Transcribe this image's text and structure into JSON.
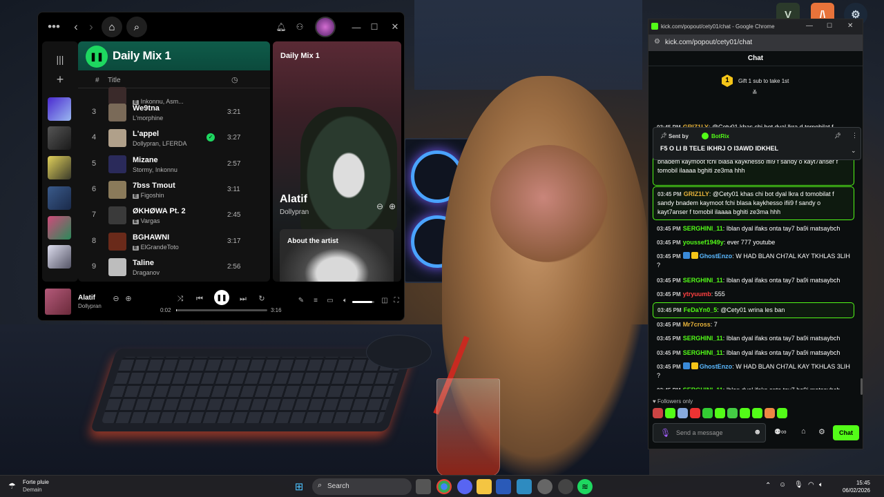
{
  "spotify": {
    "playlist_title": "Daily Mix 1",
    "col_index": "#",
    "col_title": "Title",
    "rows": [
      {
        "num": "",
        "name": "",
        "artist": "Inkonnu, Asm...",
        "explicit": true,
        "duration": "",
        "liked": false,
        "color": "#3a2a2a"
      },
      {
        "num": "3",
        "name": "We9tna",
        "artist": "L'morphine",
        "explicit": false,
        "duration": "3:21",
        "liked": false,
        "color": "#7a6a58"
      },
      {
        "num": "4",
        "name": "L'appel",
        "artist": "Dollypran, LFERDA",
        "explicit": false,
        "duration": "3:27",
        "liked": true,
        "color": "#b0a08a"
      },
      {
        "num": "5",
        "name": "Mizane",
        "artist": "Stormy, Inkonnu",
        "explicit": false,
        "duration": "2:57",
        "liked": false,
        "color": "#2a2a5a"
      },
      {
        "num": "6",
        "name": "7bss Tmout",
        "artist": "Figoshin",
        "explicit": true,
        "duration": "3:11",
        "liked": false,
        "color": "#8a7a5a"
      },
      {
        "num": "7",
        "name": "ØKHØWA Pt. 2",
        "artist": "Vargas",
        "explicit": true,
        "duration": "2:45",
        "liked": false,
        "color": "#3a3a3a"
      },
      {
        "num": "8",
        "name": "BGHAWNI",
        "artist": "ElGrandeToto",
        "explicit": true,
        "duration": "3:17",
        "liked": false,
        "color": "#6a2a1a"
      },
      {
        "num": "9",
        "name": "Taline",
        "artist": "Draganov",
        "explicit": false,
        "duration": "2:56",
        "liked": false,
        "color": "#bdbdbd"
      }
    ],
    "now_playing_panel": {
      "heading": "Daily Mix 1",
      "artist": "Alatif",
      "subtitle": "Dollypran",
      "about_label": "About the artist"
    },
    "player": {
      "track": "Alatif",
      "artist": "Dollypran",
      "elapsed": "0:02",
      "total": "3:16",
      "progress": 0.01,
      "volume": 0.9
    }
  },
  "chrome": {
    "window_title": "kick.com/popout/cety01/chat - Google Chrome",
    "url": "kick.com/popout/cety01/chat",
    "chat_header": "Chat",
    "gift_badge": "1",
    "gift_text": "Gift 1 sub to take 1st",
    "pinned": {
      "sent_by_label": "Sent by",
      "sender": "BotRix",
      "text": "F5 O LI B TELE IKHRJ O I3AWD IDKHEL"
    },
    "messages": [
      {
        "time": "03:45 PM",
        "user": "GRIZ1LY",
        "color": "#e7b33a",
        "text": "@Cety01 khas chi bot dyal lkra d tomobilat f sandy",
        "highlight": false
      },
      {
        "time": "03:45 PM",
        "user": "",
        "color": "#ffffff",
        "text": "bnadem kaymoot fchi blasa kaykhesso ifii9 f sandy o kayt7anser f tomobil ilaaaa bghiti ze3ma hhh",
        "highlight": true
      },
      {
        "time": "03:45 PM",
        "user": "GRIZ1LY",
        "color": "#e7b33a",
        "text": "@Cety01 khas chi bot dyal lkra d tomobilat f sandy bnadem kaymoot fchi blasa kaykhesso ifii9 f sandy o kayt7anser f tomobil ilaaaa bghiti ze3ma hhh",
        "highlight": true
      },
      {
        "time": "03:45 PM",
        "user": "SERGHINI_11",
        "color": "#53fc18",
        "text": "Iblan dyal ifaks onta tay7 ba9i matsaybch",
        "highlight": false
      },
      {
        "time": "03:45 PM",
        "user": "youssef1949y",
        "color": "#53fc18",
        "text": "ever 777 youtube",
        "highlight": false
      },
      {
        "time": "03:45 PM",
        "user": "GhostEnzo",
        "color": "#5ab8ff",
        "text": "W HAD BLAN CH7AL KAY TKHLAS 3LIH ?",
        "highlight": false
      },
      {
        "time": "03:45 PM",
        "user": "SERGHINI_11",
        "color": "#53fc18",
        "text": "Iblan dyal ifaks onta tay7 ba9i matsaybch",
        "highlight": false
      },
      {
        "time": "03:45 PM",
        "user": "ytryuumb",
        "color": "#ff4040",
        "text": "555",
        "highlight": false
      },
      {
        "time": "03:45 PM",
        "user": "FeDaYn0_5",
        "color": "#53fc18",
        "text": "@Cety01 wrina les ban",
        "highlight": true
      },
      {
        "time": "03:45 PM",
        "user": "Mr7cross",
        "color": "#e7b33a",
        "text": "7",
        "highlight": false
      },
      {
        "time": "03:45 PM",
        "user": "SERGHINI_11",
        "color": "#53fc18",
        "text": "Iblan dyal ifaks onta tay7 ba9i matsaybch",
        "highlight": false
      },
      {
        "time": "03:45 PM",
        "user": "SERGHINI_11",
        "color": "#53fc18",
        "text": "Iblan dyal ifaks onta tay7 ba9i matsaybch",
        "highlight": false
      },
      {
        "time": "03:45 PM",
        "user": "GhostEnzo",
        "color": "#5ab8ff",
        "text": "W HAD BLAN CH7AL KAY TKHLAS 3LIH ?",
        "highlight": false
      },
      {
        "time": "03:45 PM",
        "user": "SERGHINI_11",
        "color": "#53fc18",
        "text": "Iblan dyal ifaks onta tay7 ba9i matsaybch",
        "highlight": false
      },
      {
        "time": "03:45 PM",
        "user": "youssef1949y",
        "color": "#53fc18",
        "text": "ever 777 youtube",
        "highlight": false
      }
    ],
    "followers_only": "Followers only",
    "input_placeholder": "Send a message",
    "chat_button": "Chat"
  },
  "taskbar": {
    "weather_title": "Forte pluie",
    "weather_sub": "Demain",
    "search_label": "Search",
    "time": "15:45",
    "date": "06/02/2026"
  },
  "colors": {
    "spotify_green": "#1ed760",
    "kick_green": "#53fc18"
  }
}
